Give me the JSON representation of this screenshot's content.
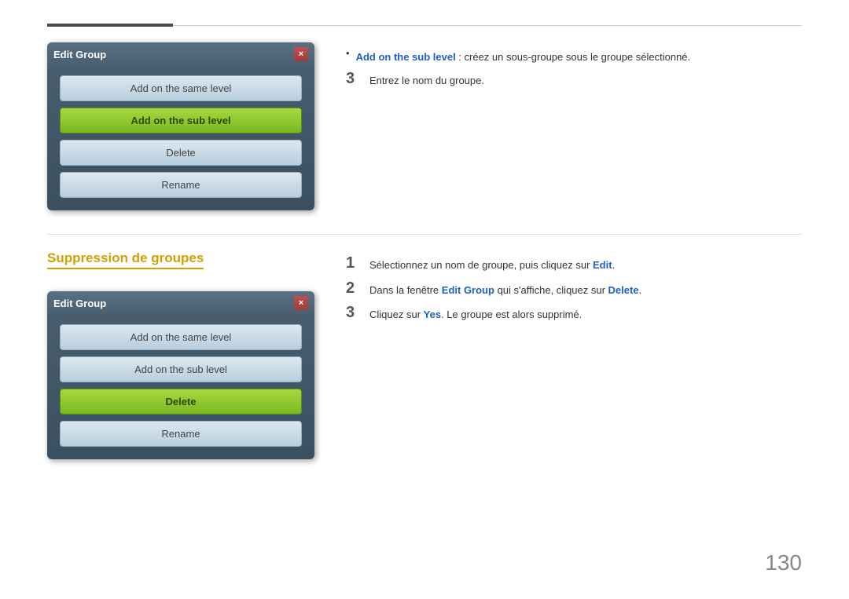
{
  "page": {
    "number": "130"
  },
  "section_top": {
    "dialog": {
      "title": "Edit Group",
      "close_btn_label": "×",
      "buttons": [
        {
          "label": "Add on the same level",
          "type": "normal"
        },
        {
          "label": "Add on the sub level",
          "type": "active_green"
        },
        {
          "label": "Delete",
          "type": "normal"
        },
        {
          "label": "Rename",
          "type": "normal"
        }
      ]
    },
    "instructions": {
      "bullet": {
        "link": "Add on the sub level",
        "text": " : créez un sous-groupe sous le groupe sélectionné."
      },
      "steps": [
        {
          "num": "3",
          "text": "Entrez le nom du groupe."
        }
      ]
    }
  },
  "section_bottom": {
    "section_title": "Suppression de groupes",
    "dialog": {
      "title": "Edit Group",
      "close_btn_label": "×",
      "buttons": [
        {
          "label": "Add on the same level",
          "type": "normal"
        },
        {
          "label": "Add on the sub level",
          "type": "normal"
        },
        {
          "label": "Delete",
          "type": "active_green"
        },
        {
          "label": "Rename",
          "type": "normal"
        }
      ]
    },
    "instructions": {
      "steps": [
        {
          "num": "1",
          "before": "Sélectionnez un nom de groupe, puis cliquez sur ",
          "link": "Edit",
          "after": "."
        },
        {
          "num": "2",
          "before": "Dans la fenêtre ",
          "link1": "Edit Group",
          "middle": " qui s'affiche, cliquez sur ",
          "link2": "Delete",
          "after": "."
        },
        {
          "num": "3",
          "before": "Cliquez sur ",
          "link": "Yes",
          "after": ". Le groupe est alors supprimé."
        }
      ]
    }
  }
}
